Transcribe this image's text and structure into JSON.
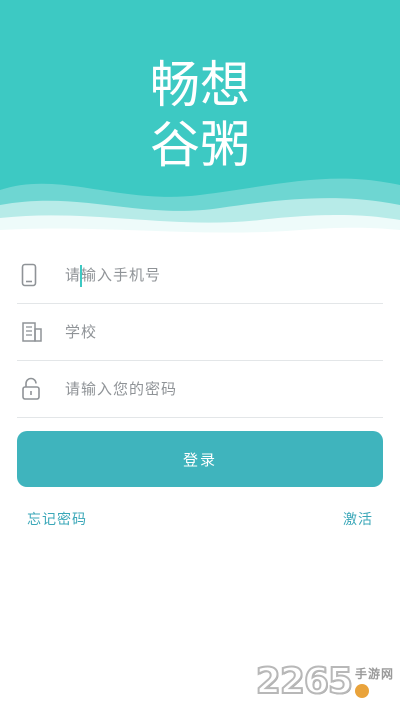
{
  "brand": {
    "logo_line1": "畅想",
    "logo_line2": "谷粥"
  },
  "form": {
    "phone_placeholder": "请输入手机号",
    "school_placeholder": "学校",
    "password_placeholder": "请输入您的密码"
  },
  "actions": {
    "login_label": "登录",
    "forgot_label": "忘记密码",
    "activate_label": "激活"
  },
  "watermark": {
    "number": "2265",
    "site": "手游网"
  },
  "colors": {
    "header": "#3dc9c3",
    "button": "#3fb4bd",
    "link": "#3aa7b8"
  },
  "icons": {
    "phone": "phone-icon",
    "school": "building-icon",
    "password": "unlock-icon"
  }
}
